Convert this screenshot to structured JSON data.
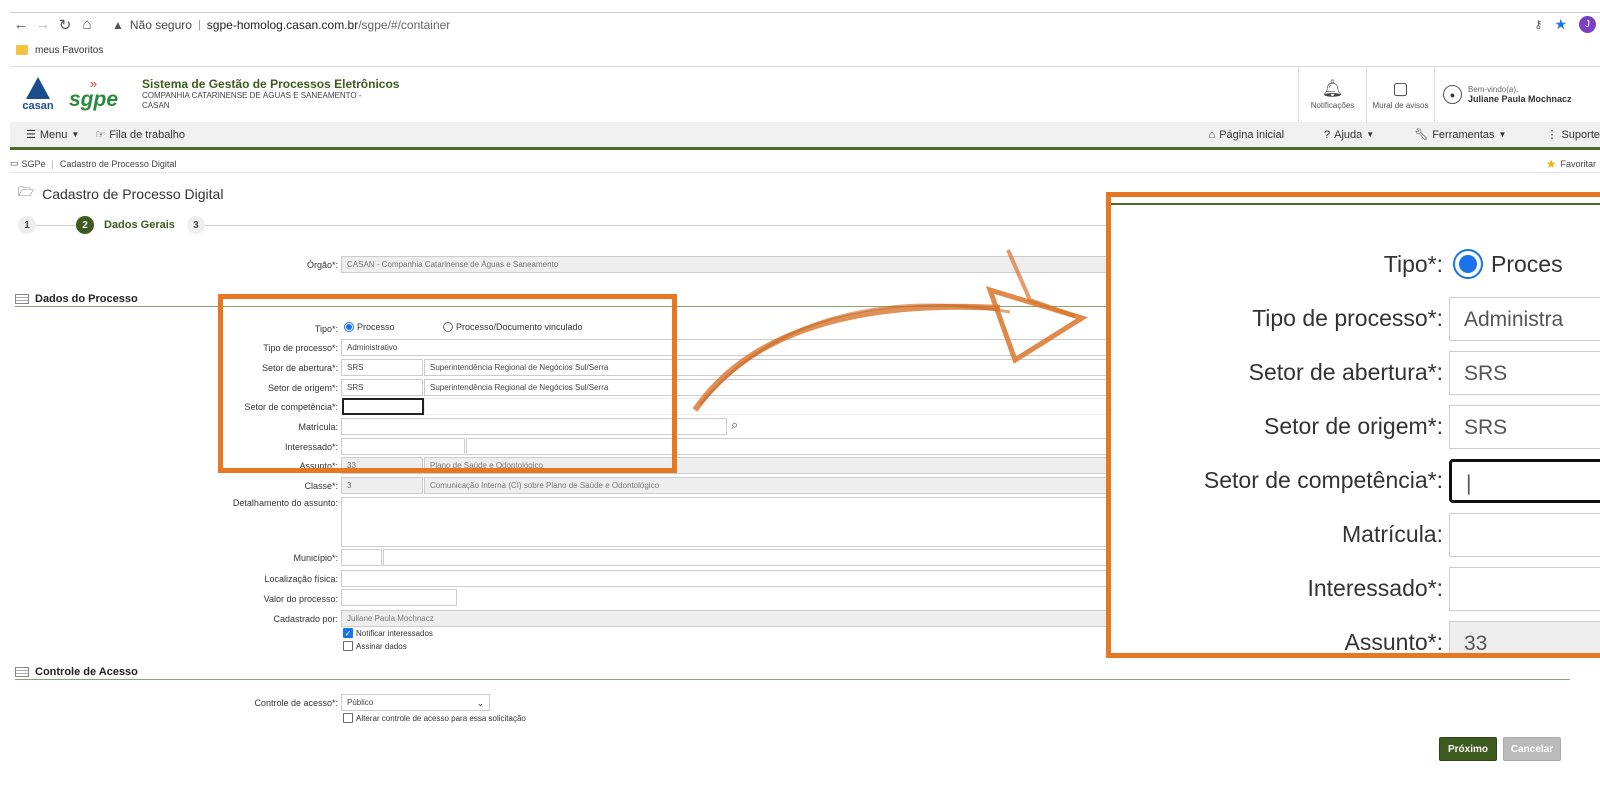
{
  "browser": {
    "warning": "Não seguro",
    "domain": "sgpe-homolog.casan.com.br",
    "path": "/sgpe/#/container",
    "avatar_letter": "J",
    "bookmark": "meus Favoritos"
  },
  "header": {
    "casan_word": "casan",
    "sgpe_word": "sgpe",
    "title": "Sistema de Gestão de Processos Eletrônicos",
    "subtitle1": "COMPANHIA CATARINENSE DE ÁGUAS E SANEAMENTO -",
    "subtitle2": "CASAN",
    "notifications": "Notificações",
    "mural": "Mural de avisos",
    "welcome": "Bem-vindo(a),",
    "user_name": "Juliane Paula Mochnacz"
  },
  "menubar": {
    "menu": "Menu",
    "fila": "Fila de trabalho",
    "home": "Página inicial",
    "help": "Ajuda",
    "tools": "Ferramentas",
    "support": "Suporte"
  },
  "breadcrumb": {
    "root": "SGPe",
    "current": "Cadastro de Processo Digital",
    "favorite": "Favoritar"
  },
  "page": {
    "title": "Cadastro de Processo Digital",
    "steps": [
      "1",
      "2",
      "3"
    ],
    "active_step_label": "Dados Gerais"
  },
  "form": {
    "orgao_label": "Órgão*:",
    "orgao_value": "CASAN - Companhia Catarinense de Águas e Saneamento",
    "section_processo": "Dados do Processo",
    "tipo_label": "Tipo*:",
    "tipo_opt1": "Processo",
    "tipo_opt2": "Processo/Documento vinculado",
    "tipo_processo_label": "Tipo de processo*:",
    "tipo_processo_value": "Administrativo",
    "setor_abertura_label": "Setor de abertura*:",
    "setor_abertura_code": "SRS",
    "setor_abertura_name": "Superintendência Regional de Negócios Sul/Serra",
    "setor_origem_label": "Setor de origem*:",
    "setor_origem_code": "SRS",
    "setor_origem_name": "Superintendência Regional de Negócios Sul/Serra",
    "setor_competencia_label": "Setor de competência*:",
    "matricula_label": "Matrícula:",
    "interessado_label": "Interessado*:",
    "assunto_label": "Assunto*:",
    "assunto_code": "33",
    "assunto_name": "Plano de Saúde e Odontológico",
    "classe_label": "Classe*:",
    "classe_code": "3",
    "classe_name": "Comunicação Interna (CI) sobre Plano de Saúde e Odontológico",
    "detalhamento_label": "Detalhamento do assunto:",
    "municipio_label": "Município*:",
    "localizacao_label": "Localização física:",
    "valor_label": "Valor do processo:",
    "cadastrado_label": "Cadastrado por:",
    "cadastrado_value": "Juliane Paula Mochnacz",
    "notificar": "Notificar interessados",
    "assinar": "Assinar dados",
    "section_acesso": "Controle de Acesso",
    "controle_label": "Controle de acesso*:",
    "controle_value": "Público",
    "alterar_controle": "Alterar controle de acesso para essa solicitação"
  },
  "zoom": {
    "tipo_label": "Tipo*:",
    "tipo_value": "Proces",
    "tipo_processo_label": "Tipo de processo*:",
    "tipo_processo_value": "Administra",
    "setor_abertura_label": "Setor de abertura*:",
    "setor_abertura_value": "SRS",
    "setor_origem_label": "Setor de origem*:",
    "setor_origem_value": "SRS",
    "setor_competencia_label": "Setor de competência*:",
    "matricula_label": "Matrícula:",
    "interessado_label": "Interessado*:",
    "assunto_label": "Assunto*:",
    "assunto_value": "33"
  },
  "buttons": {
    "next": "Próximo",
    "cancel": "Cancelar"
  },
  "colors": {
    "brand_green": "#3d5a1f",
    "highlight_orange": "#e87722"
  }
}
